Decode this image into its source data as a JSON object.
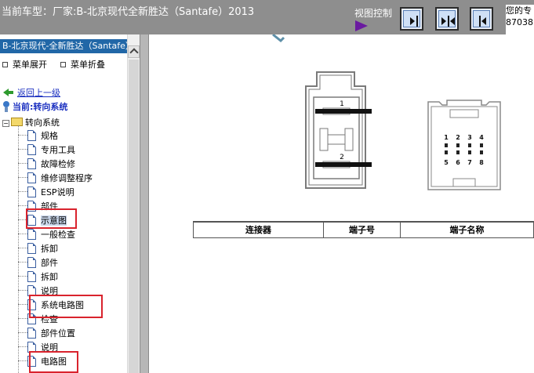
{
  "header": {
    "title": "当前车型：厂家:B-北京现代全新胜达（Santafe）2013",
    "view_control_label": "视图控制",
    "right_text_line1": "您的专",
    "right_text_line2": "87038"
  },
  "sidebar": {
    "vehicle_label": "B-北京现代-全新胜达（Santafe）",
    "expand_label": "菜单展开",
    "collapse_label": "菜单折叠",
    "back_label": "返回上一级",
    "current_label": "当前:转向系统",
    "folder_label": "转向系统",
    "items": [
      {
        "label": "规格"
      },
      {
        "label": "专用工具"
      },
      {
        "label": "故障检修"
      },
      {
        "label": "维修调整程序"
      },
      {
        "label": "ESP说明"
      },
      {
        "label": "部件"
      },
      {
        "label": "示意图",
        "selected": true
      },
      {
        "label": "一般检查"
      },
      {
        "label": "拆卸"
      },
      {
        "label": "部件"
      },
      {
        "label": "拆卸"
      },
      {
        "label": "说明"
      },
      {
        "label": "系统电路图"
      },
      {
        "label": "检查"
      },
      {
        "label": "部件位置"
      },
      {
        "label": "说明"
      },
      {
        "label": "电路图"
      }
    ]
  },
  "diagram": {
    "connector1_pin_labels": [
      "1",
      "2"
    ],
    "connector2_pin_labels": [
      "1",
      "2",
      "3",
      "4",
      "5",
      "6",
      "7",
      "8"
    ]
  },
  "table": {
    "headers": [
      "连接器",
      "端子号",
      "端子名称"
    ]
  },
  "colors": {
    "topbar": "#8e8e8e",
    "vehicle_bar": "#2167a7",
    "highlight_box": "#d9232d",
    "link": "#1a2fc0"
  }
}
